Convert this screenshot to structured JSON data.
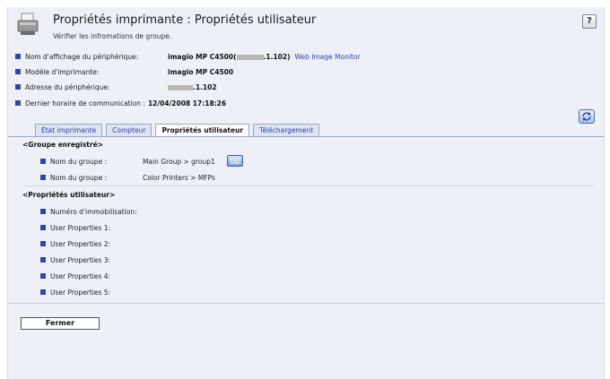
{
  "header": {
    "title": "Propriétés imprimante : Propriétés utilisateur",
    "subtitle": "Vérifier les infromations de groupe.",
    "help_label": "?"
  },
  "device_info": [
    {
      "label": "Nom d'affichage du périphérique:",
      "value_prefix": "imagio MP C4500(",
      "value_suffix": ".1.102)",
      "link": "Web Image Monitor"
    },
    {
      "label": "Modèle d'imprimante:",
      "value": "imagio MP C4500"
    },
    {
      "label": "Adresse du périphérique:",
      "value_suffix": ".1.102"
    },
    {
      "label": "Dernier horaire de communication :",
      "value": "12/04/2008 17:18:26"
    }
  ],
  "tabs": [
    {
      "label": "État imprimante",
      "active": false
    },
    {
      "label": "Compteur",
      "active": false
    },
    {
      "label": "Propriétés utilisateur",
      "active": true
    },
    {
      "label": "Téléchargement",
      "active": false
    }
  ],
  "group_section": {
    "title": "<Groupe enregistré>",
    "rows": [
      {
        "label": "Nom du groupe :",
        "value": "Main Group > group1"
      },
      {
        "label": "Nom du groupe :",
        "value": "Color Printers > MFPs"
      }
    ]
  },
  "user_section": {
    "title": "<Propriétés utilisateur>",
    "rows": [
      {
        "label": "Numéro d'immobilisation:"
      },
      {
        "label": "User Properties 1:"
      },
      {
        "label": "User Properties 2:"
      },
      {
        "label": "User Properties 3:"
      },
      {
        "label": "User Properties 4:"
      },
      {
        "label": "User Properties 5:"
      }
    ]
  },
  "footer": {
    "close_label": "Fermer"
  },
  "icons": {
    "printer": "printer-icon",
    "help": "help-icon",
    "refresh": "refresh-icon",
    "group_detail": "group-detail-icon"
  },
  "colors": {
    "accent": "#2c47a6",
    "link": "#2a45a8",
    "panel_bg": "#edf0f7"
  }
}
